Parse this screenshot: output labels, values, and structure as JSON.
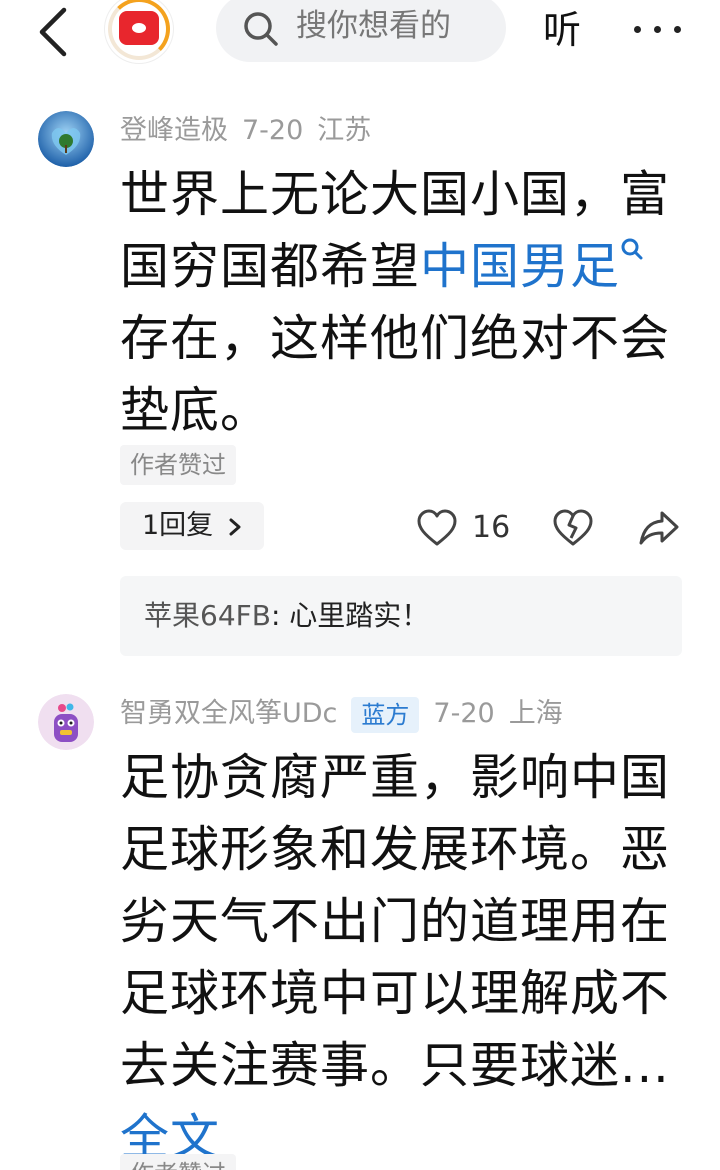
{
  "topbar": {
    "search_placeholder": "搜你想看的",
    "listen_label": "听"
  },
  "comments": [
    {
      "username": "登峰造极",
      "date": "7-20",
      "location": "江苏",
      "text_part1": "世界上无论大国小国，富国穷国都希望",
      "link_text": "中国男足",
      "text_part2": "存在，这样他们绝对不会垫底。",
      "author_liked_label": "作者赞过",
      "replies_label": "1回复",
      "like_count": "16",
      "reply_preview": {
        "user": "苹果64FB",
        "text": "心里踏实！"
      }
    },
    {
      "username": "智勇双全风筝UDc",
      "badge": "蓝方",
      "date": "7-20",
      "location": "上海",
      "text": "足协贪腐严重，影响中国足球形象和发展环境。恶劣天气不出门的道理用在足球环境中可以理解成不去关注赛事。只要球迷...",
      "more_label": "全文",
      "author_liked_label": "作者赞过"
    }
  ],
  "icons": {
    "back": "chevron-left-icon",
    "search": "search-icon",
    "more": "more-dots-icon",
    "like": "heart-icon",
    "dislike": "broken-heart-icon",
    "share": "share-arrow-icon"
  },
  "colors": {
    "link": "#1f73cc",
    "meta_gray": "#9a9a9a",
    "badge_blue": "#2b7bd0",
    "app_red": "#e8262d",
    "app_orange": "#f4a21e"
  }
}
